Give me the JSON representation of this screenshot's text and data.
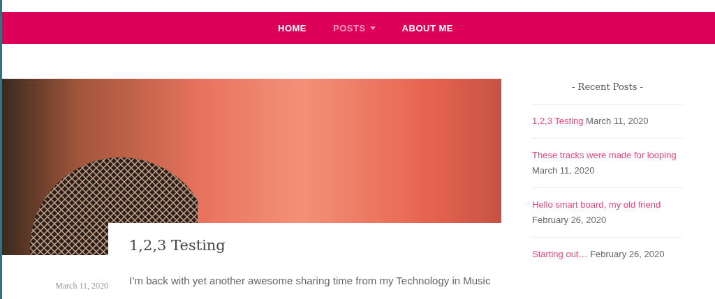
{
  "nav": [
    {
      "label": "HOME",
      "selected": false,
      "has_dropdown": false
    },
    {
      "label": "POSTS",
      "selected": true,
      "has_dropdown": true
    },
    {
      "label": "ABOUT ME",
      "selected": false,
      "has_dropdown": false
    }
  ],
  "post": {
    "title": "1,2,3 Testing",
    "date": "March 11, 2020",
    "excerpt": "I’m back with yet another awesome sharing time from my Technology in Music"
  },
  "sidebar": {
    "title": "- Recent Posts -",
    "items": [
      {
        "title": "1,2,3 Testing",
        "date": "March 11, 2020"
      },
      {
        "title": "These tracks were made for looping",
        "date": "March 11, 2020"
      },
      {
        "title": "Hello smart board, my old friend",
        "date": "February 26, 2020"
      },
      {
        "title": "Starting out…",
        "date": "February 26, 2020"
      }
    ]
  }
}
